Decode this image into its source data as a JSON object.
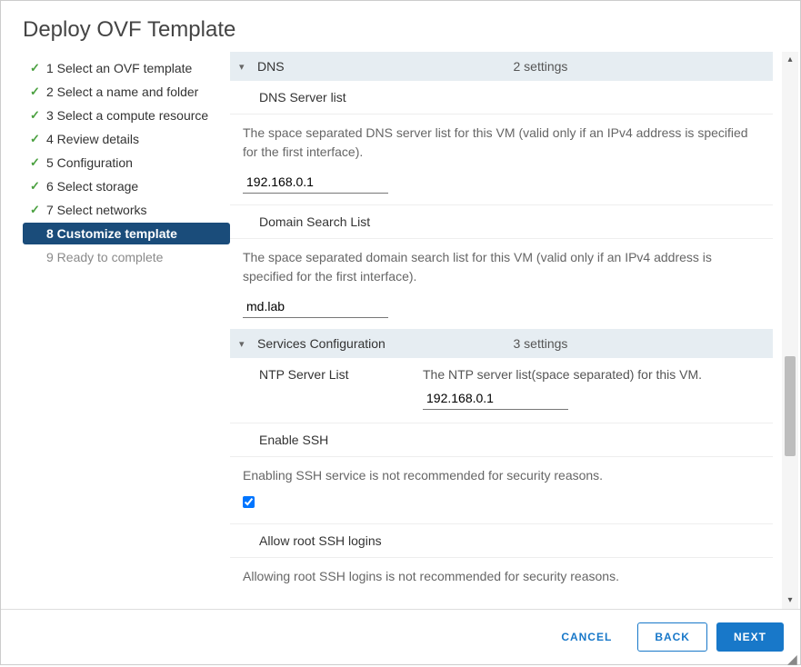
{
  "title": "Deploy OVF Template",
  "steps": [
    {
      "label": "1 Select an OVF template",
      "state": "done"
    },
    {
      "label": "2 Select a name and folder",
      "state": "done"
    },
    {
      "label": "3 Select a compute resource",
      "state": "done"
    },
    {
      "label": "4 Review details",
      "state": "done"
    },
    {
      "label": "5 Configuration",
      "state": "done"
    },
    {
      "label": "6 Select storage",
      "state": "done"
    },
    {
      "label": "7 Select networks",
      "state": "done"
    },
    {
      "label": "8 Customize template",
      "state": "active"
    },
    {
      "label": "9 Ready to complete",
      "state": "pending"
    }
  ],
  "sections": {
    "dns": {
      "label": "DNS",
      "count": "2 settings",
      "fields": {
        "server_list": {
          "label": "DNS Server list",
          "help": "The space separated DNS server list for this VM (valid only if an IPv4 address is specified for the first interface).",
          "value": "192.168.0.1"
        },
        "domain_search": {
          "label": "Domain Search List",
          "help": "The space separated domain search list for this VM (valid only if an IPv4 address is specified for the first interface).",
          "value": "md.lab"
        }
      }
    },
    "services": {
      "label": "Services Configuration",
      "count": "3 settings",
      "fields": {
        "ntp": {
          "label": "NTP Server List",
          "desc": "The NTP server list(space separated) for this VM.",
          "value": "192.168.0.1"
        },
        "ssh": {
          "label": "Enable SSH",
          "help": "Enabling SSH service is not recommended for security reasons.",
          "checked": true
        },
        "root_ssh": {
          "label": "Allow root SSH logins",
          "help": "Allowing root SSH logins is not recommended for security reasons."
        }
      }
    }
  },
  "footer": {
    "cancel": "CANCEL",
    "back": "BACK",
    "next": "NEXT"
  }
}
